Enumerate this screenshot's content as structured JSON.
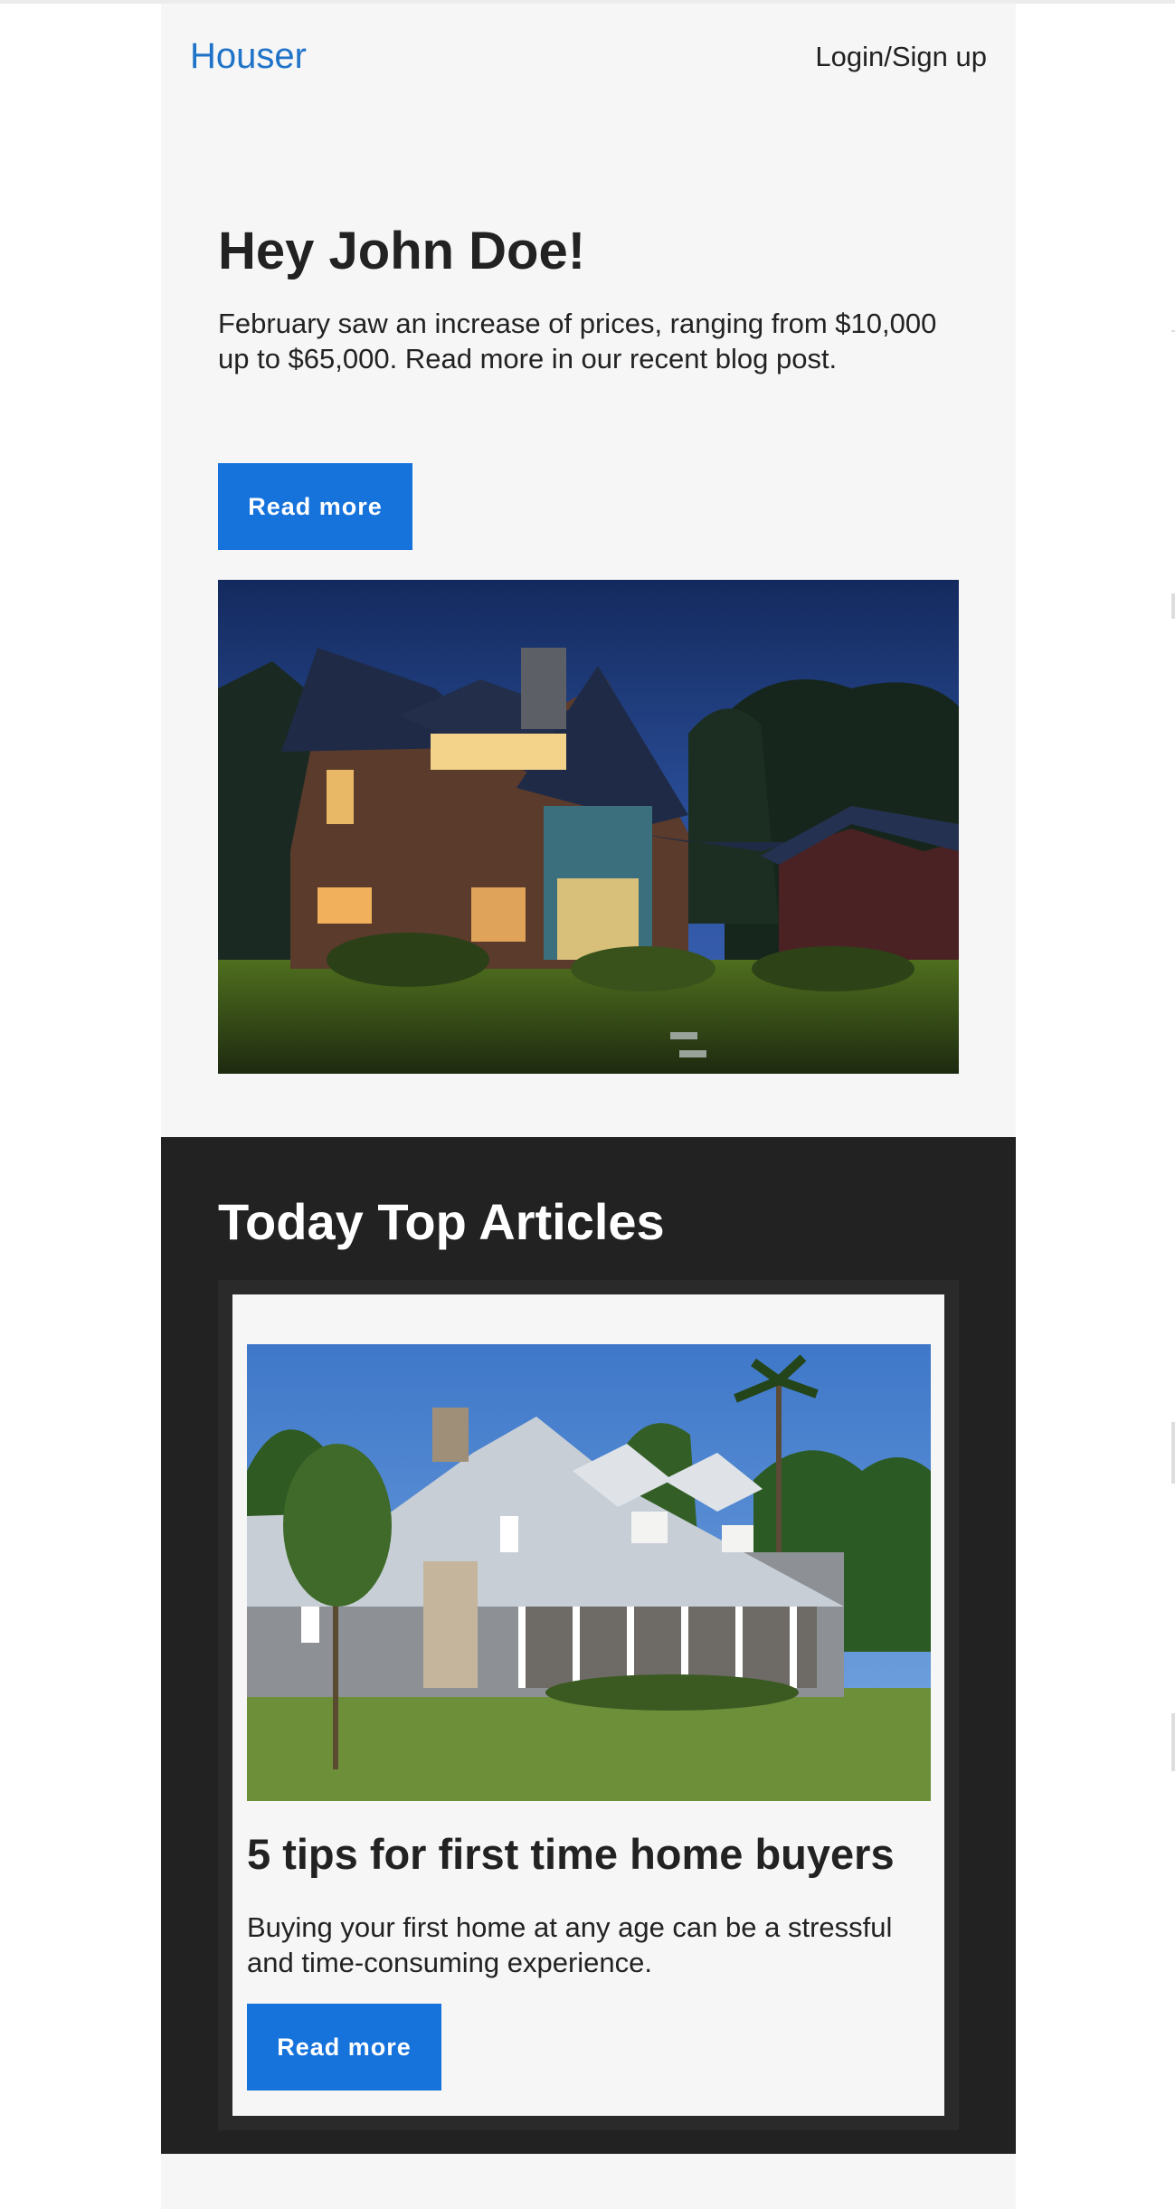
{
  "header": {
    "brand": "Houser",
    "login_label": "Login/Sign up"
  },
  "hero": {
    "title": "Hey John Doe!",
    "text": "February saw an increase of prices, ranging from $10,000 up to $65,000. Read more in our recent blog post.",
    "button_label": "Read more",
    "image_icon": "house-at-dusk-image"
  },
  "articles": {
    "title": "Today Top Articles",
    "items": [
      {
        "title": "5 tips for first time home buyers",
        "text": "Buying your first home at any age can be a stressful and time-consuming experience.",
        "button_label": "Read more",
        "image_icon": "house-daytime-image"
      }
    ]
  },
  "colors": {
    "brand": "#1f73c8",
    "button": "#1673dc",
    "dark_section": "#222222",
    "page": "#f6f6f6"
  }
}
